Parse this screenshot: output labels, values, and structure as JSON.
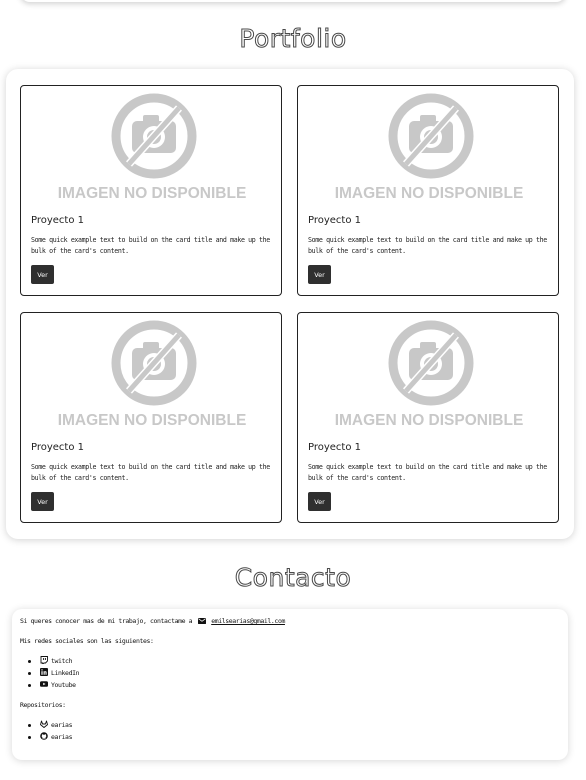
{
  "portfolio": {
    "title": "Portfolio",
    "cards": [
      {
        "image_text": "IMAGEN NO DISPONIBLE",
        "title": "Proyecto 1",
        "text": "Some quick example text to build on the card title and make up the bulk of the card's content.",
        "button": "Ver"
      },
      {
        "image_text": "IMAGEN NO DISPONIBLE",
        "title": "Proyecto 1",
        "text": "Some quick example text to build on the card title and make up the bulk of the card's content.",
        "button": "Ver"
      },
      {
        "image_text": "IMAGEN NO DISPONIBLE",
        "title": "Proyecto 1",
        "text": "Some quick example text to build on the card title and make up the bulk of the card's content.",
        "button": "Ver"
      },
      {
        "image_text": "IMAGEN NO DISPONIBLE",
        "title": "Proyecto 1",
        "text": "Some quick example text to build on the card title and make up the bulk of the card's content.",
        "button": "Ver"
      }
    ],
    "image_icon": "no-camera-icon"
  },
  "contact": {
    "title": "Contacto",
    "intro": "Si queres conocer mas de mi trabajo, contactame a",
    "email": "emilsearias@gmail.com",
    "social_heading": "Mis redes sociales son las siguientes:",
    "social": [
      {
        "icon": "twitch-icon",
        "label": "twitch"
      },
      {
        "icon": "linkedin-icon",
        "label": "LinkedIn"
      },
      {
        "icon": "youtube-icon",
        "label": "Youtube"
      }
    ],
    "repos_heading": "Repositorios:",
    "repos": [
      {
        "icon": "gitlab-icon",
        "label": "earias"
      },
      {
        "icon": "github-icon",
        "label": "earias"
      }
    ]
  },
  "colors": {
    "button_bg": "#2f2f2f",
    "placeholder_gray": "#c8c8c8",
    "title_stroke": "#4a4a4a"
  }
}
